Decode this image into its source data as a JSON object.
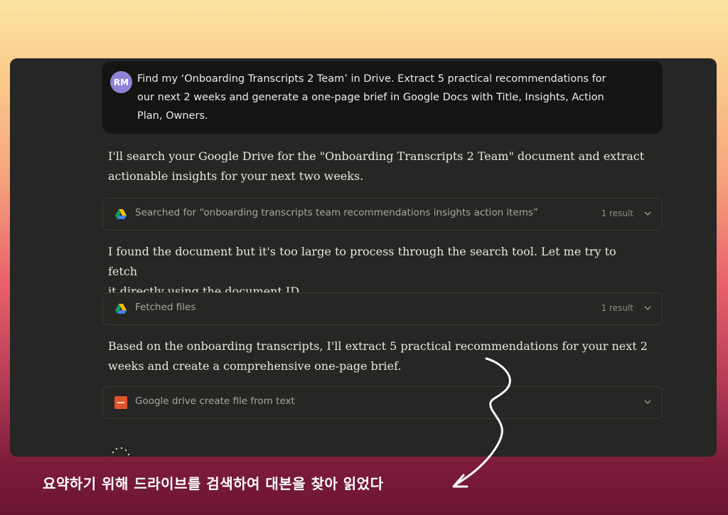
{
  "user_message": {
    "avatar_initials": "RM",
    "lines": [
      "Find my ‘Onboarding Transcripts 2 Team’ in Drive. Extract 5 practical recommendations for",
      "our next 2 weeks and generate a one-page brief in Google Docs with Title, Insights, Action",
      "Plan, Owners."
    ]
  },
  "assistant": {
    "para1": [
      "I'll search your Google Drive for the \"Onboarding Transcripts 2 Team\" document and extract",
      "actionable insights for your next two weeks."
    ],
    "para2": [
      "I found the document but it's too large to process through the search tool. Let me try to fetch",
      "it directly using the document ID."
    ],
    "para3": [
      "Based on the onboarding transcripts, I'll extract 5 practical recommendations for your next 2",
      "weeks and create a comprehensive one-page brief."
    ]
  },
  "tools": [
    {
      "icon": "google-drive-icon",
      "label": "Searched for “onboarding transcripts team recommendations insights action items”",
      "meta": "1 result"
    },
    {
      "icon": "google-drive-icon",
      "label": "Fetched files",
      "meta": "1 result"
    },
    {
      "icon": "file-create-icon",
      "label": "Google drive create file from text",
      "meta": ""
    }
  ],
  "caption": "요약하기 위해 드라이브를 검색하여 대본을 찾아 읽었다",
  "colors": {
    "panel": "#262624",
    "user_bubble": "#141413",
    "avatar": "#8e83d6",
    "annotation": "#ffffff"
  }
}
